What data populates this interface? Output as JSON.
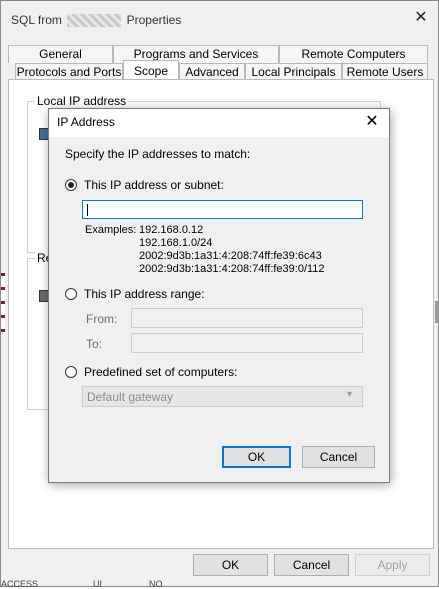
{
  "bg": {
    "title_left": "SQL from",
    "title_right": "Properties",
    "tabs_top": [
      "General",
      "Programs and Services",
      "Remote Computers"
    ],
    "tabs_bottom": [
      "Protocols and Ports",
      "Scope",
      "Advanced",
      "Local Principals",
      "Remote Users"
    ],
    "local_ip_label": "Local IP address",
    "remote_label_fragment": "Re",
    "ok": "OK",
    "cancel": "Cancel",
    "apply": "Apply",
    "bottom_fragments": [
      "ACCESS",
      "UI",
      "NO"
    ]
  },
  "dialog": {
    "title": "IP Address",
    "prompt": "Specify the IP addresses to match:",
    "option_subnet": "This IP address or subnet:",
    "subnet_value": "",
    "examples_label": "Examples:",
    "examples": [
      "192.168.0.12",
      "192.168.1.0/24",
      "2002:9d3b:1a31:4:208:74ff:fe39:6c43",
      "2002:9d3b:1a31:4:208:74ff:fe39:0/112"
    ],
    "option_range": "This IP address range:",
    "from_label": "From:",
    "to_label": "To:",
    "option_predefined": "Predefined set of computers:",
    "predefined_value": "Default gateway",
    "ok": "OK",
    "cancel": "Cancel"
  }
}
